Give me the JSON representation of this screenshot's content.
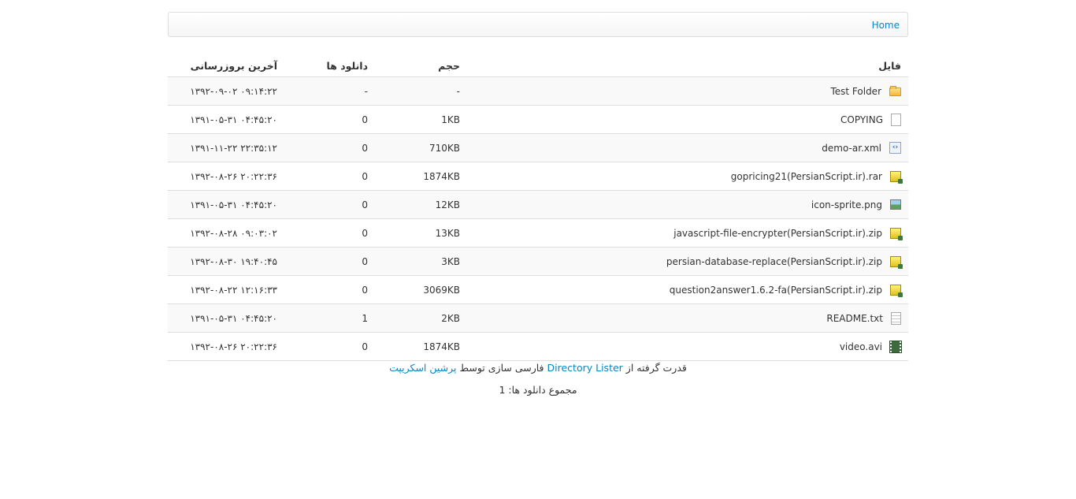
{
  "breadcrumb": {
    "home_label": "Home"
  },
  "table": {
    "headers": {
      "file": "فایل",
      "size": "حجم",
      "downloads": "دانلود ها",
      "updated": "آخرین بروزرسانی"
    },
    "rows": [
      {
        "icon": "folder-icon",
        "name": "Test Folder",
        "size": "-",
        "downloads": "-",
        "date": "۱۳۹۲-۰۹-۰۲ ۰۹:۱۴:۲۲"
      },
      {
        "icon": "blank-file-icon",
        "name": "COPYING",
        "size": "1KB",
        "downloads": "0",
        "date": "۱۳۹۱-۰۵-۳۱ ۰۴:۴۵:۲۰"
      },
      {
        "icon": "code-file-icon",
        "name": "demo-ar.xml",
        "size": "710KB",
        "downloads": "0",
        "date": "۱۳۹۱-۱۱-۲۲ ۲۲:۳۵:۱۲"
      },
      {
        "icon": "archive-icon",
        "name": "gopricing21(PersianScript.ir).rar",
        "size": "1874KB",
        "downloads": "0",
        "date": "۱۳۹۲-۰۸-۲۶ ۲۰:۲۲:۳۶"
      },
      {
        "icon": "image-file-icon",
        "name": "icon-sprite.png",
        "size": "12KB",
        "downloads": "0",
        "date": "۱۳۹۱-۰۵-۳۱ ۰۴:۴۵:۲۰"
      },
      {
        "icon": "archive-icon",
        "name": "javascript-file-encrypter(PersianScript.ir).zip",
        "size": "13KB",
        "downloads": "0",
        "date": "۱۳۹۲-۰۸-۲۸ ۰۹:۰۳:۰۲"
      },
      {
        "icon": "archive-icon",
        "name": "persian-database-replace(PersianScript.ir).zip",
        "size": "3KB",
        "downloads": "0",
        "date": "۱۳۹۲-۰۸-۳۰ ۱۹:۴۰:۴۵"
      },
      {
        "icon": "archive-icon",
        "name": "question2answer1.6.2-fa(PersianScript.ir).zip",
        "size": "3069KB",
        "downloads": "0",
        "date": "۱۳۹۲-۰۸-۲۲ ۱۲:۱۶:۳۳"
      },
      {
        "icon": "text-file-icon",
        "name": "README.txt",
        "size": "2KB",
        "downloads": "1",
        "date": "۱۳۹۱-۰۵-۳۱ ۰۴:۴۵:۲۰"
      },
      {
        "icon": "video-file-icon",
        "name": "video.avi",
        "size": "1874KB",
        "downloads": "0",
        "date": "۱۳۹۲-۰۸-۲۶ ۲۰:۲۲:۳۶"
      }
    ]
  },
  "footer": {
    "powered_prefix": "قدرت گرفته از",
    "powered_link": "Directory Lister",
    "translated_text": "فارسی سازی توسط",
    "translator_link": "پرشین اسکریپت",
    "total_downloads": "مجموع دانلود ها: 1"
  }
}
